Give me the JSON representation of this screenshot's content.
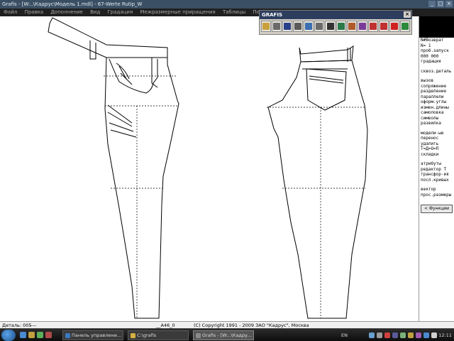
{
  "titlebar": {
    "title": "Grafis - [W:..\\Кадрус\\Модель 1.mdl] - 67-Werte Rutip_W",
    "minimize": "_",
    "restore": "□",
    "close": "×"
  },
  "menubar": {
    "items": [
      "Файл",
      "Правка",
      "Дополнение",
      "Вид",
      "Градация",
      "Межразмерные приращения",
      "Таблицы",
      "Помощь"
    ]
  },
  "toolbar": {
    "title": "GRAFIS",
    "close": "×",
    "buttons": [
      {
        "name": "open-folder",
        "color": "#c9a03a"
      },
      {
        "name": "print",
        "color": "#6a6a6a"
      },
      {
        "name": "save",
        "color": "#2a3f8a"
      },
      {
        "name": "zoom",
        "color": "#5a5a5a"
      },
      {
        "name": "layers",
        "color": "#3a6fb0"
      },
      {
        "name": "grid",
        "color": "#6a6a6a"
      },
      {
        "name": "dimension",
        "color": "#333333"
      },
      {
        "name": "globe",
        "color": "#2a7a4a"
      },
      {
        "name": "pattern",
        "color": "#b05a2a"
      },
      {
        "name": "measure",
        "color": "#7a3a9a"
      },
      {
        "name": "fill-down",
        "color": "#c03030"
      },
      {
        "name": "fill-up",
        "color": "#c03030"
      },
      {
        "name": "stop",
        "color": "#d02020"
      },
      {
        "name": "chart",
        "color": "#2a8a3a"
      }
    ]
  },
  "rightpanel": {
    "groups": [
      [
        "N#Возврат",
        "N=  1",
        "проб.запуск",
        " 000 000",
        "градация"
      ],
      [
        "сквоз.деталь"
      ],
      [
        "вызов",
        "сопряжение",
        "разделение",
        "параллели",
        "оформ.углы",
        "измен.длины",
        "самоловка",
        "символы",
        "развилка"
      ],
      [
        "модели-ые",
        "перенос",
        "удалить",
        "Т=Д=О=П",
        "складки"
      ],
      [
        "атрибуты",
        "редактор Т",
        "трансфор-ия",
        "посл.кривых"
      ],
      [
        "вектор",
        "прос.размеры"
      ]
    ],
    "function_button": "< Функции"
  },
  "statusbar": {
    "detail": "Деталь: 005",
    "dashes": "----",
    "code": "__A46_0",
    "copyright": "(C) Copyright 1991 - 2009 ЗАО \"Кадрус\", Москва"
  },
  "taskbar": {
    "tasks": [
      {
        "label": "Панель управлени...",
        "icon_color": "#3a7ac0",
        "active": false
      },
      {
        "label": "C:\\grafis",
        "icon_color": "#d4b040",
        "active": false
      },
      {
        "label": "Grafis - [W:..\\Кадру...",
        "icon_color": "#8a8a8a",
        "active": true
      }
    ],
    "language": "EN",
    "clock": "12:11"
  }
}
